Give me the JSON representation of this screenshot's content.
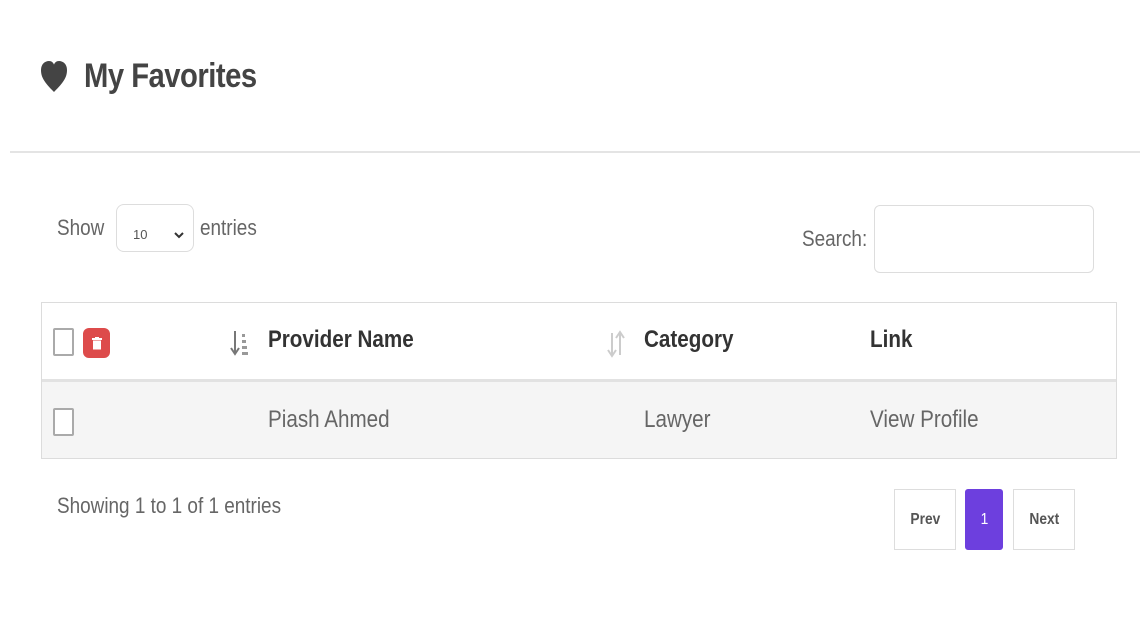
{
  "header": {
    "title": "My Favorites",
    "icon": "heart-icon"
  },
  "controls": {
    "show_label": "Show",
    "entries_label": "entries",
    "page_length": "10",
    "search_label": "Search:",
    "search_value": ""
  },
  "table": {
    "columns": [
      "Provider Name",
      "Category",
      "Link"
    ],
    "rows": [
      {
        "provider": "Piash Ahmed",
        "category": "Lawyer",
        "link": "View Profile"
      }
    ]
  },
  "footer": {
    "info": "Showing 1 to 1 of 1 entries",
    "prev": "Prev",
    "page": "1",
    "next": "Next"
  },
  "colors": {
    "accent": "#6d3fde",
    "delete": "#dd4b4b",
    "heading_icon": "#444444"
  }
}
